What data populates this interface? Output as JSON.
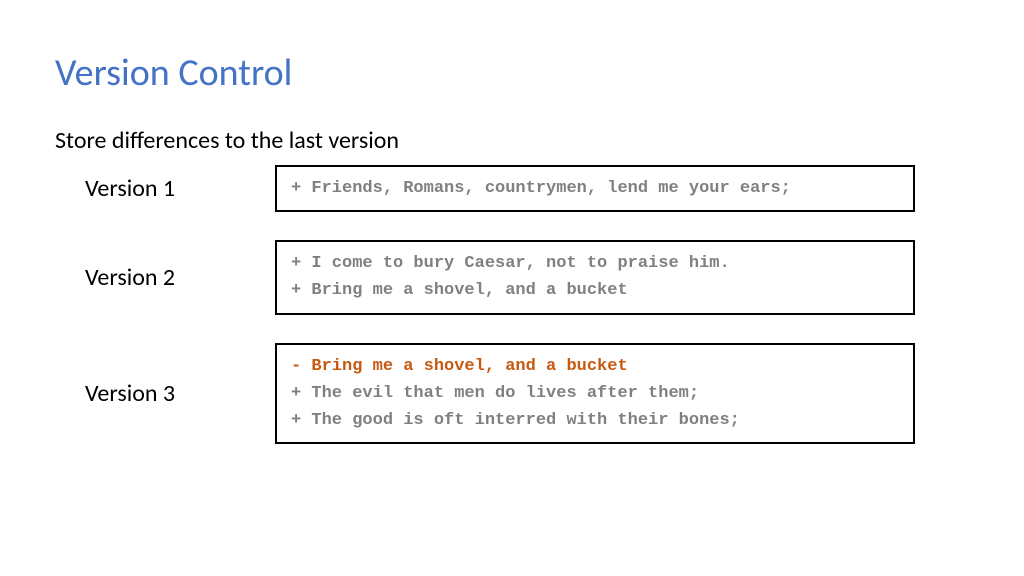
{
  "title": "Version Control",
  "subtitle": "Store differences to the last version",
  "versions": [
    {
      "label": "Version 1",
      "lines": [
        {
          "text": "+ Friends, Romans, countrymen, lend me your ears;",
          "type": "add"
        }
      ]
    },
    {
      "label": "Version 2",
      "lines": [
        {
          "text": "+ I come to bury Caesar, not to praise him.",
          "type": "add"
        },
        {
          "text": "+ Bring me a shovel, and a bucket",
          "type": "add"
        }
      ]
    },
    {
      "label": "Version 3",
      "lines": [
        {
          "text": "- Bring me a shovel, and a bucket",
          "type": "remove"
        },
        {
          "text": "+ The evil that men do lives after them;",
          "type": "add"
        },
        {
          "text": "+ The good is oft interred with their bones;",
          "type": "add"
        }
      ]
    }
  ]
}
